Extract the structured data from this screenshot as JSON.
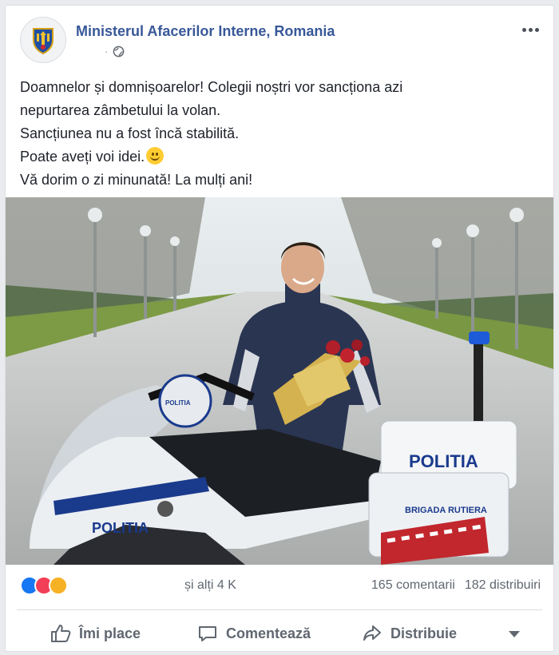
{
  "post": {
    "author": "Ministerul Afacerilor Interne, Romania",
    "timestamp": "·",
    "privacy_icon": "globe-icon",
    "text_lines": [
      "Doamnelor și domnișoarelor! Colegii noștri vor sancționa azi",
      "nepurtarea zâmbetului la volan.",
      "Sancțiunea nu a fost încă stabilită.",
      "Poate aveți voi idei.",
      "Vă dorim o zi minunată! La mulți ani!"
    ],
    "emoji": "smile-emoji"
  },
  "photo": {
    "motorcycle_labels": [
      "POLITIA",
      "POLITIA",
      "POLITIA",
      "BRIGADA RUTIERA"
    ]
  },
  "stats": {
    "reactions_text": "și alți 4 K",
    "comments": "165 comentarii",
    "shares": "182 distribuiri",
    "reaction_types": [
      "like",
      "love",
      "haha"
    ]
  },
  "actions": {
    "like": "Îmi place",
    "comment": "Comentează",
    "share": "Distribuie"
  },
  "colors": {
    "brand_blue": "#385898",
    "like_blue": "#1877f2",
    "love_red": "#f33e58",
    "haha_yellow": "#f7b125"
  }
}
